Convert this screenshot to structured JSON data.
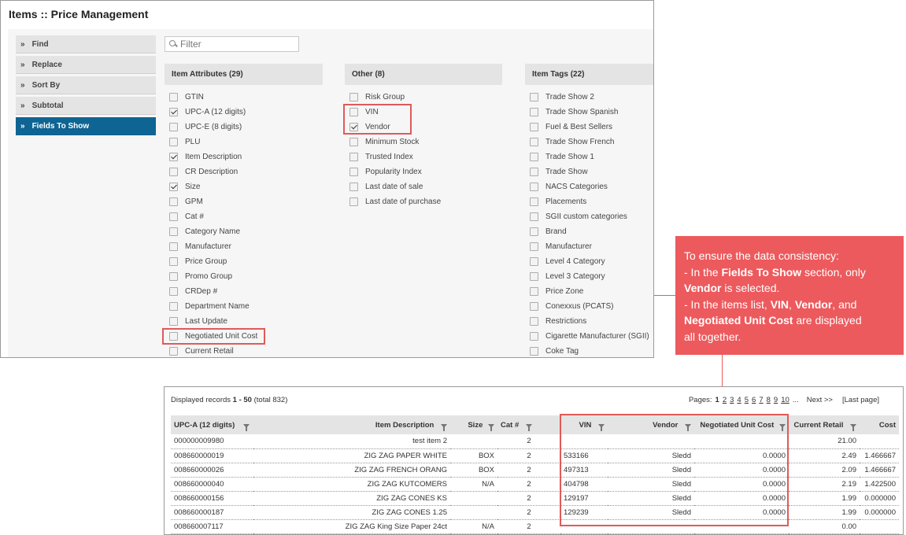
{
  "window": {
    "title": "Items :: Price Management"
  },
  "sidebar": {
    "items": [
      {
        "label": "Find",
        "active": false
      },
      {
        "label": "Replace",
        "active": false
      },
      {
        "label": "Sort By",
        "active": false
      },
      {
        "label": "Subtotal",
        "active": false
      },
      {
        "label": "Fields To Show",
        "active": true
      }
    ]
  },
  "filter": {
    "placeholder": "Filter"
  },
  "columns": [
    {
      "heading": "Item Attributes (29)",
      "options": [
        {
          "label": "GTIN",
          "checked": false
        },
        {
          "label": "UPC-A (12 digits)",
          "checked": true
        },
        {
          "label": "UPC-E (8 digits)",
          "checked": false
        },
        {
          "label": "PLU",
          "checked": false
        },
        {
          "label": "Item Description",
          "checked": true
        },
        {
          "label": "CR Description",
          "checked": false
        },
        {
          "label": "Size",
          "checked": true
        },
        {
          "label": "GPM",
          "checked": false
        },
        {
          "label": "Cat #",
          "checked": false
        },
        {
          "label": "Category Name",
          "checked": false
        },
        {
          "label": "Manufacturer",
          "checked": false
        },
        {
          "label": "Price Group",
          "checked": false
        },
        {
          "label": "Promo Group",
          "checked": false
        },
        {
          "label": "CRDep #",
          "checked": false
        },
        {
          "label": "Department Name",
          "checked": false
        },
        {
          "label": "Last Update",
          "checked": false
        },
        {
          "label": "Negotiated Unit Cost",
          "checked": false
        },
        {
          "label": "Current Retail",
          "checked": false
        }
      ]
    },
    {
      "heading": "Other (8)",
      "options": [
        {
          "label": "Risk Group",
          "checked": false
        },
        {
          "label": "VIN",
          "checked": false
        },
        {
          "label": "Vendor",
          "checked": true
        },
        {
          "label": "Minimum Stock",
          "checked": false
        },
        {
          "label": "Trusted Index",
          "checked": false
        },
        {
          "label": "Popularity Index",
          "checked": false
        },
        {
          "label": "Last date of sale",
          "checked": false
        },
        {
          "label": "Last date of purchase",
          "checked": false
        }
      ]
    },
    {
      "heading": "Item Tags (22)",
      "options": [
        {
          "label": "Trade Show 2",
          "checked": false
        },
        {
          "label": "Trade Show Spanish",
          "checked": false
        },
        {
          "label": "Fuel & Best Sellers",
          "checked": false
        },
        {
          "label": "Trade Show French",
          "checked": false
        },
        {
          "label": "Trade Show 1",
          "checked": false
        },
        {
          "label": "Trade Show",
          "checked": false
        },
        {
          "label": "NACS Categories",
          "checked": false
        },
        {
          "label": "Placements",
          "checked": false
        },
        {
          "label": "SGII custom categories",
          "checked": false
        },
        {
          "label": "Brand",
          "checked": false
        },
        {
          "label": "Manufacturer",
          "checked": false
        },
        {
          "label": "Level 4 Category",
          "checked": false
        },
        {
          "label": "Level 3 Category",
          "checked": false
        },
        {
          "label": "Price Zone",
          "checked": false
        },
        {
          "label": "Conexxus (PCATS)",
          "checked": false
        },
        {
          "label": "Restrictions",
          "checked": false
        },
        {
          "label": "Cigarette Manufacturer (SGII)",
          "checked": false
        },
        {
          "label": "Coke Tag",
          "checked": false
        }
      ]
    }
  ],
  "callout": {
    "line1": "To ensure the data consistency:",
    "line2_pre": "- In the ",
    "line2_bold": "Fields To Show",
    "line2_post": " section, only",
    "line3_bold": "Vendor",
    "line3_post": " is selected.",
    "line4_pre": "- In the items list, ",
    "line4_b1": "VIN",
    "line4_sep1": ", ",
    "line4_b2": "Vendor",
    "line4_sep2": ", and",
    "line5_bold": "Negotiated Unit Cost",
    "line5_post": " are displayed",
    "line6": "all together."
  },
  "list": {
    "records_prefix": "Displayed records ",
    "records_range": "1 - 50",
    "records_total": " (total 832)",
    "pager": {
      "label": "Pages:",
      "pages": [
        "1",
        "2",
        "3",
        "4",
        "5",
        "6",
        "7",
        "8",
        "9",
        "10"
      ],
      "ellipsis": "...",
      "next": "Next >>",
      "last": "[Last page]"
    },
    "headers": [
      "UPC-A (12 digits)",
      "Item Description",
      "Size",
      "Cat #",
      "VIN",
      "Vendor",
      "Negotiated Unit Cost",
      "Current Retail",
      "Cost"
    ],
    "rows": [
      [
        "000000009980",
        "test item 2",
        "",
        "2",
        "",
        "",
        "",
        "21.00",
        ""
      ],
      [
        "008660000019",
        "ZIG ZAG PAPER WHITE",
        "BOX",
        "2",
        "533166",
        "Sledd",
        "0.0000",
        "2.49",
        "1.466667"
      ],
      [
        "008660000026",
        "ZIG ZAG FRENCH ORANG",
        "BOX",
        "2",
        "497313",
        "Sledd",
        "0.0000",
        "2.09",
        "1.466667"
      ],
      [
        "008660000040",
        "ZIG ZAG KUTCOMERS",
        "N/A",
        "2",
        "404798",
        "Sledd",
        "0.0000",
        "2.19",
        "1.422500"
      ],
      [
        "008660000156",
        "ZIG ZAG CONES KS",
        "",
        "2",
        "129197",
        "Sledd",
        "0.0000",
        "1.99",
        "0.000000"
      ],
      [
        "008660000187",
        "ZIG ZAG CONES 1.25",
        "",
        "2",
        "129239",
        "Sledd",
        "0.0000",
        "1.99",
        "0.000000"
      ],
      [
        "008660007117",
        "ZIG ZAG King Size Paper 24ct",
        "N/A",
        "2",
        "",
        "",
        "",
        "0.00",
        ""
      ]
    ]
  },
  "colors": {
    "accent": "#0e6492",
    "callout": "#ec5a5d",
    "highlight": "#e05a5a"
  }
}
